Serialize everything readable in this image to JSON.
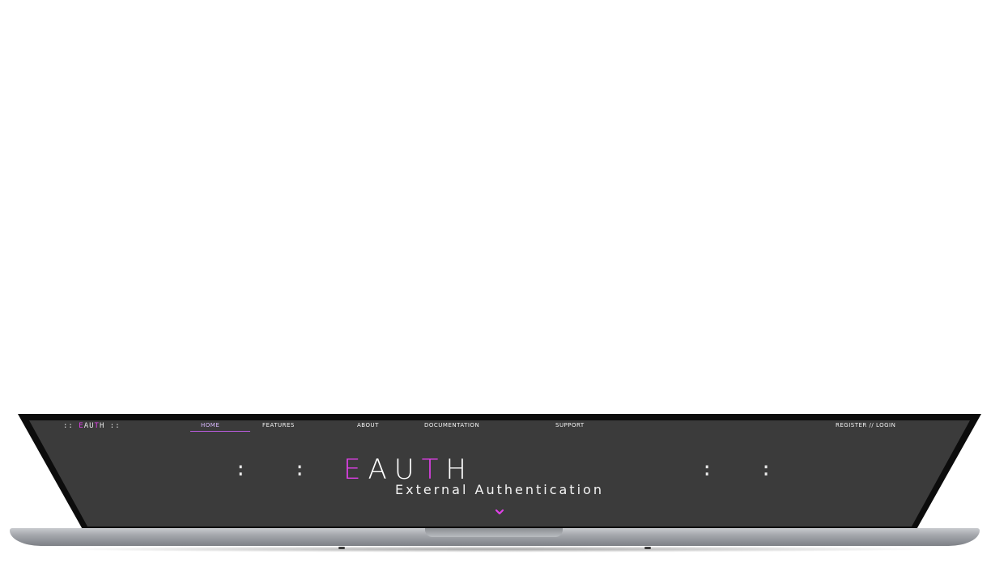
{
  "colors": {
    "accent": "#e040e8",
    "screen_bg": "#3b3b3b",
    "text": "#ffffff"
  },
  "nav": {
    "logo_prefix": ":: E",
    "logo_mid": "AU",
    "logo_pink2": "T",
    "logo_suffix": "H ::",
    "items": [
      {
        "label": "HOME"
      },
      {
        "label": "FEATURES"
      },
      {
        "label": "ABOUT"
      },
      {
        "label": "DOCUMENTATION"
      },
      {
        "label": "SUPPORT"
      }
    ],
    "right_link": "REGISTER // LOGIN"
  },
  "hero": {
    "brand_letters": [
      "E",
      "A",
      "U",
      "T",
      "H"
    ],
    "brand_colors": [
      "#e040e8",
      "#ffffff",
      "#ffffff",
      "#e040e8",
      "#ffffff"
    ],
    "left_dots": ": :",
    "right_dots": ": :",
    "subtitle": "External Authentication",
    "scroll_icon": "chevron-down-icon"
  }
}
